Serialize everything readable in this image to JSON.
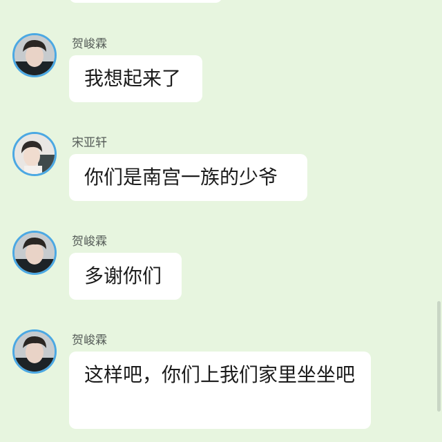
{
  "messages": [
    {
      "sender": "贺峻霖",
      "text": "我想起来了",
      "avatar": "avatar-he-junlin"
    },
    {
      "sender": "宋亚轩",
      "text": "你们是南宫一族的少爷",
      "avatar": "avatar-song-yaxuan"
    },
    {
      "sender": "贺峻霖",
      "text": "多谢你们",
      "avatar": "avatar-he-junlin"
    },
    {
      "sender": "贺峻霖",
      "text": "这样吧，你们上我们家里坐坐吧",
      "avatar": "avatar-he-junlin"
    }
  ],
  "colors": {
    "background": "#e7f5df",
    "bubble": "#ffffff",
    "avatar_ring": "#4ba8e3"
  }
}
